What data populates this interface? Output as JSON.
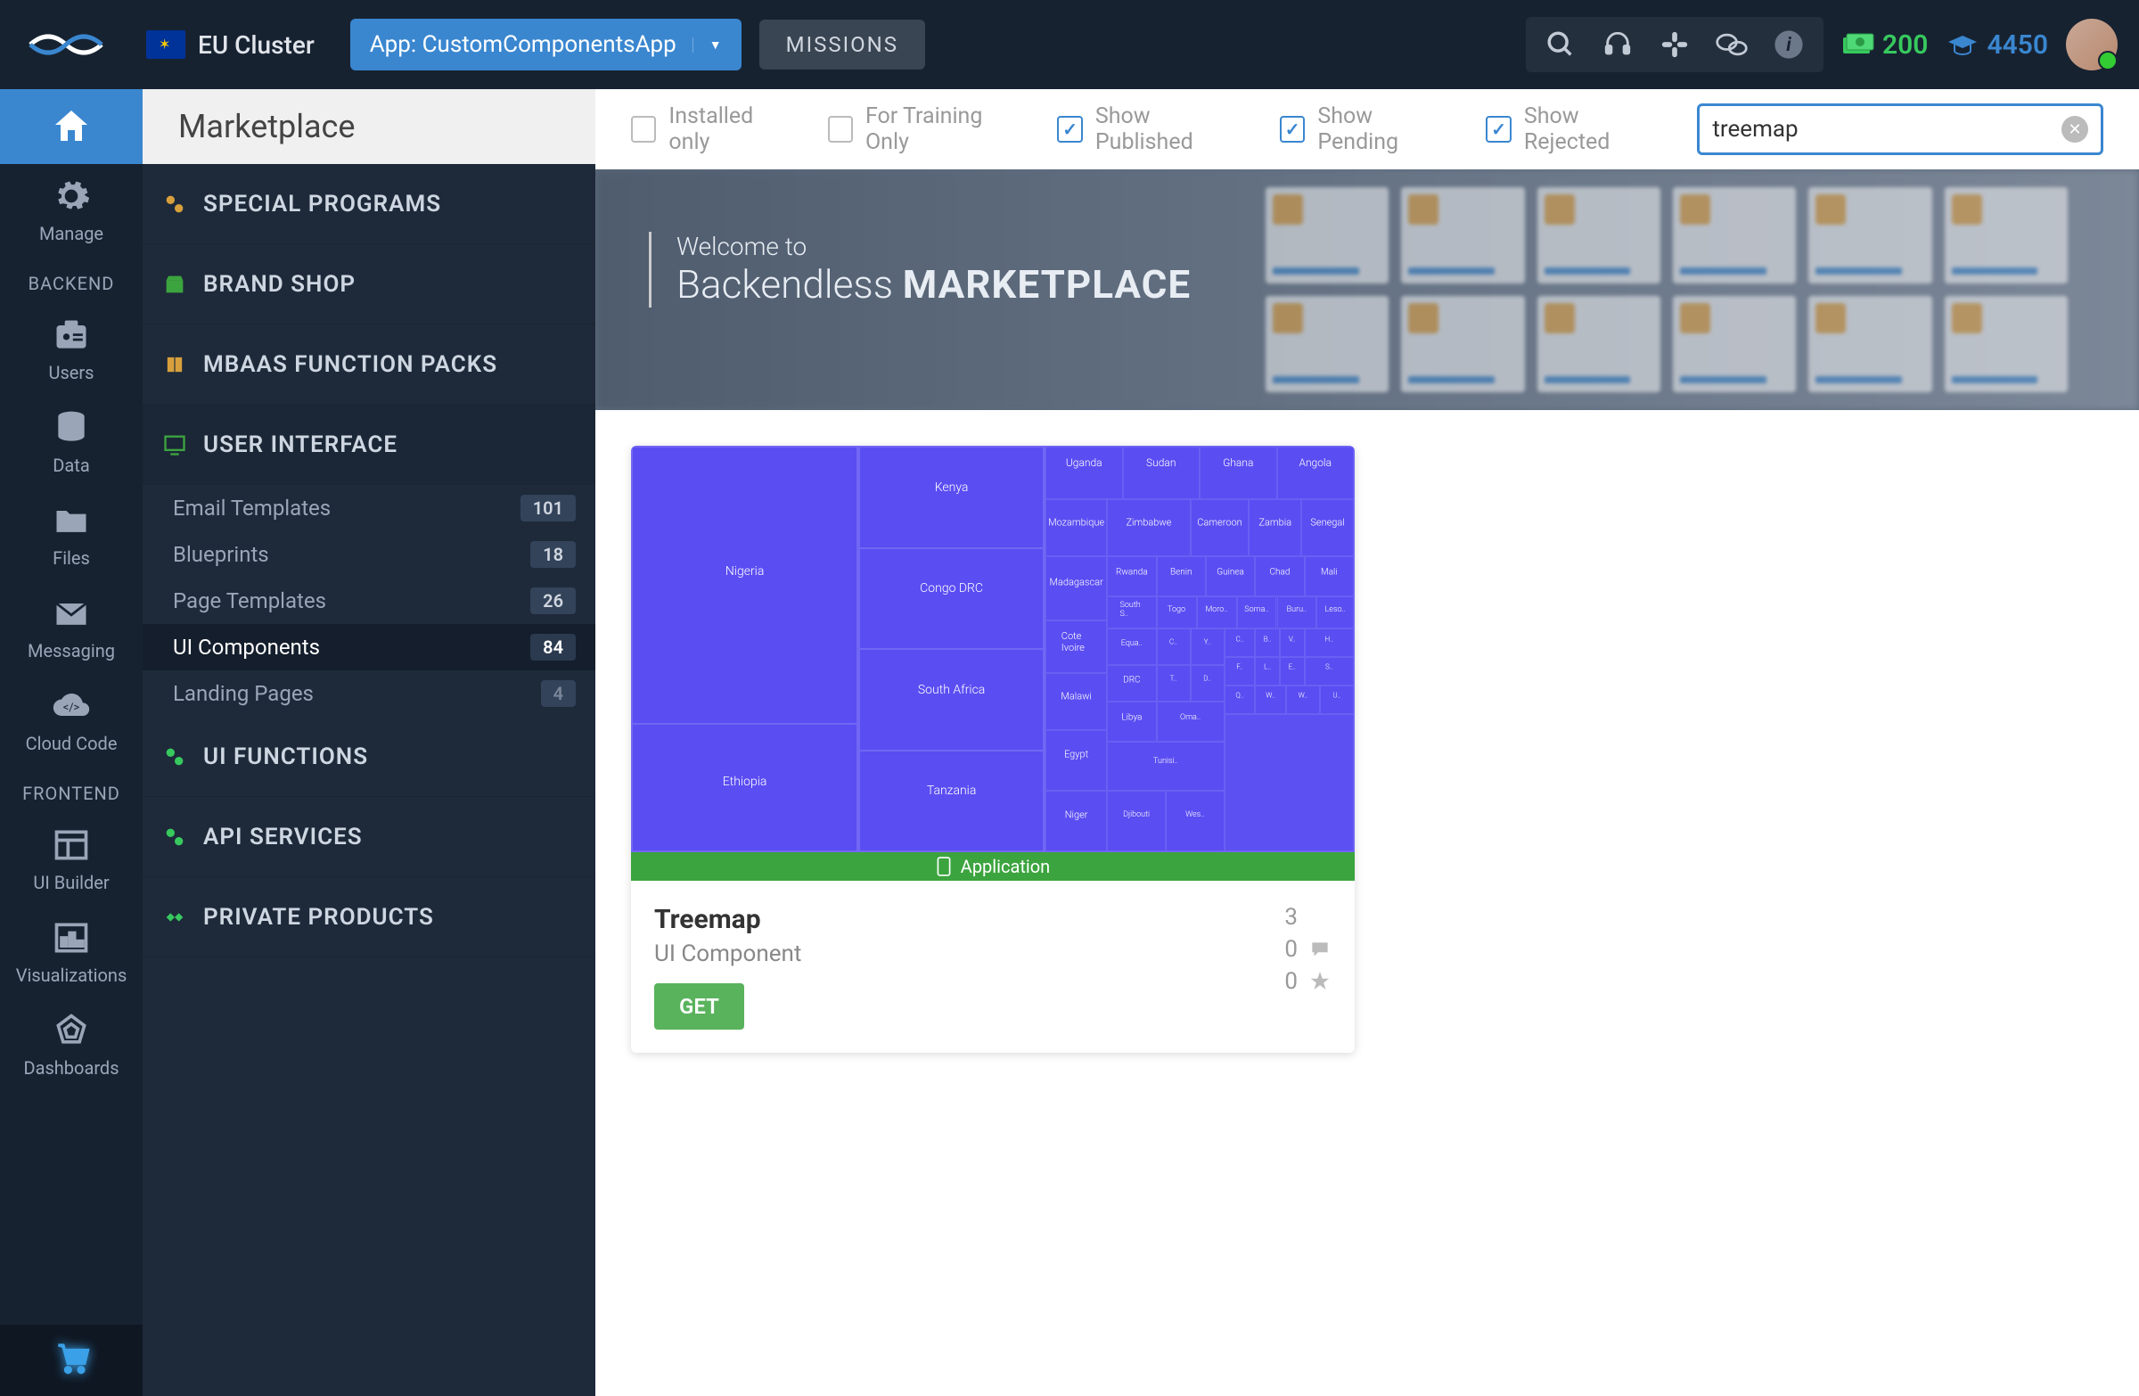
{
  "header": {
    "cluster": "EU Cluster",
    "app_label": "App: CustomComponentsApp",
    "missions": "MISSIONS",
    "money": "200",
    "edu": "4450"
  },
  "page_title": "Marketplace",
  "rail": {
    "backend_label": "BACKEND",
    "frontend_label": "FRONTEND",
    "items": {
      "manage": "Manage",
      "users": "Users",
      "data": "Data",
      "files": "Files",
      "messaging": "Messaging",
      "cloud": "Cloud Code",
      "ui_builder": "UI Builder",
      "visualizations": "Visualizations",
      "dashboards": "Dashboards"
    }
  },
  "categories": {
    "special": "SPECIAL PROGRAMS",
    "brand": "BRAND SHOP",
    "mbaas": "MBAAS FUNCTION PACKS",
    "ui": "USER INTERFACE",
    "ui_sub": [
      {
        "label": "Email Templates",
        "count": "101"
      },
      {
        "label": "Blueprints",
        "count": "18"
      },
      {
        "label": "Page Templates",
        "count": "26"
      },
      {
        "label": "UI Components",
        "count": "84"
      },
      {
        "label": "Landing Pages",
        "count": "4"
      }
    ],
    "funcs": "UI FUNCTIONS",
    "api": "API SERVICES",
    "private": "PRIVATE PRODUCTS"
  },
  "filters": {
    "installed": "Installed only",
    "training": "For Training Only",
    "published": "Show Published",
    "pending": "Show Pending",
    "rejected": "Show Rejected",
    "search_value": "treemap"
  },
  "banner": {
    "welcome": "Welcome to",
    "brand": "Backendless",
    "title": "MARKETPLACE"
  },
  "card": {
    "app_strip": "Application",
    "title": "Treemap",
    "subtitle": "UI Component",
    "get": "GET",
    "downloads": "3",
    "comments": "0",
    "stars": "0"
  }
}
